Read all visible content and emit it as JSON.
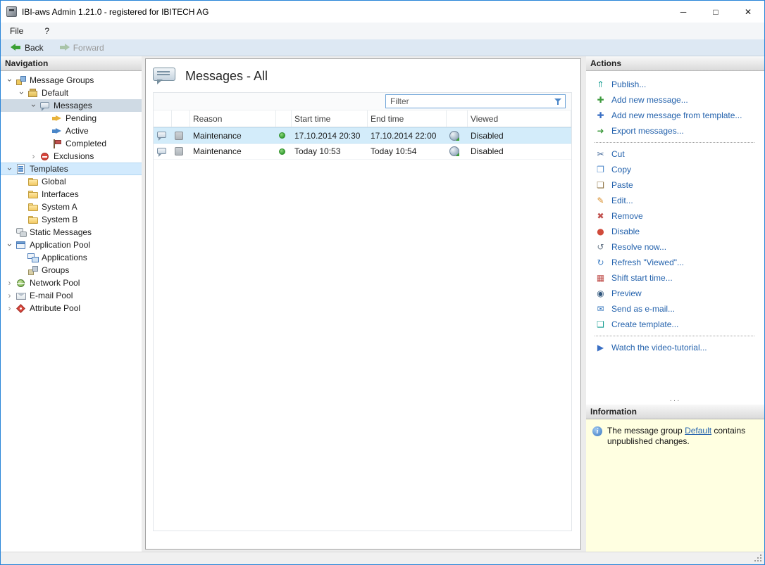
{
  "window": {
    "title": "IBI-aws Admin 1.21.0 - registered for IBITECH AG",
    "controls": {
      "minimize": "─",
      "maximize": "□",
      "close": "✕"
    }
  },
  "menu": {
    "items": [
      {
        "label": "File"
      },
      {
        "label": "?"
      }
    ]
  },
  "toolbar": {
    "back_label": "Back",
    "forward_label": "Forward"
  },
  "navigation": {
    "header": "Navigation",
    "tree": [
      {
        "label": "Message Groups",
        "level": 0,
        "children": "expanded",
        "icon": "message-groups-icon"
      },
      {
        "label": "Default",
        "level": 1,
        "children": "expanded",
        "icon": "message-group-icon"
      },
      {
        "label": "Messages",
        "level": 2,
        "children": "expanded",
        "icon": "messages-icon",
        "state": "selected"
      },
      {
        "label": "Pending",
        "level": 3,
        "children": null,
        "icon": "pending-icon"
      },
      {
        "label": "Active",
        "level": 3,
        "children": null,
        "icon": "active-icon"
      },
      {
        "label": "Completed",
        "level": 3,
        "children": null,
        "icon": "completed-icon"
      },
      {
        "label": "Exclusions",
        "level": 2,
        "children": "collapsed",
        "icon": "exclusions-icon"
      },
      {
        "label": "Templates",
        "level": 0,
        "children": "expanded",
        "icon": "templates-icon",
        "state": "highlighted"
      },
      {
        "label": "Global",
        "level": 1,
        "children": null,
        "icon": "folder-icon"
      },
      {
        "label": "Interfaces",
        "level": 1,
        "children": null,
        "icon": "folder-icon"
      },
      {
        "label": "System A",
        "level": 1,
        "children": null,
        "icon": "folder-icon"
      },
      {
        "label": "System B",
        "level": 1,
        "children": null,
        "icon": "folder-icon"
      },
      {
        "label": "Static Messages",
        "level": 0,
        "children": null,
        "icon": "static-messages-icon"
      },
      {
        "label": "Application Pool",
        "level": 0,
        "children": "expanded",
        "icon": "application-pool-icon"
      },
      {
        "label": "Applications",
        "level": 1,
        "children": null,
        "icon": "applications-icon"
      },
      {
        "label": "Groups",
        "level": 1,
        "children": null,
        "icon": "groups-icon"
      },
      {
        "label": "Network Pool",
        "level": 0,
        "children": "collapsed",
        "icon": "network-pool-icon"
      },
      {
        "label": "E-mail Pool",
        "level": 0,
        "children": "collapsed",
        "icon": "email-pool-icon"
      },
      {
        "label": "Attribute Pool",
        "level": 0,
        "children": "collapsed",
        "icon": "attribute-pool-icon"
      }
    ]
  },
  "main": {
    "title": "Messages - All",
    "filter_placeholder": "Filter",
    "table": {
      "columns": [
        "Reason",
        "Start time",
        "End time",
        "Viewed"
      ],
      "rows": [
        {
          "reason": "Maintenance",
          "status": "active",
          "start_time": "17.10.2014 20:30",
          "end_time": "17.10.2014 22:00",
          "viewed": "Disabled",
          "selected": true
        },
        {
          "reason": "Maintenance",
          "status": "active",
          "start_time": "Today 10:53",
          "end_time": "Today 10:54",
          "viewed": "Disabled",
          "selected": false
        }
      ]
    }
  },
  "actions": {
    "header": "Actions",
    "overflow_indicator": "···",
    "groups": [
      [
        {
          "label": "Publish...",
          "icon": "publish-icon"
        },
        {
          "label": "Add new message...",
          "icon": "add-message-icon"
        },
        {
          "label": "Add new message from template...",
          "icon": "add-message-template-icon"
        },
        {
          "label": "Export messages...",
          "icon": "export-messages-icon"
        }
      ],
      [
        {
          "label": "Cut",
          "icon": "cut-icon"
        },
        {
          "label": "Copy",
          "icon": "copy-icon"
        },
        {
          "label": "Paste",
          "icon": "paste-icon"
        },
        {
          "label": "Edit...",
          "icon": "edit-icon"
        },
        {
          "label": "Remove",
          "icon": "remove-icon"
        },
        {
          "label": "Disable",
          "icon": "disable-icon"
        },
        {
          "label": "Resolve now...",
          "icon": "resolve-icon"
        },
        {
          "label": "Refresh \"Viewed\"...",
          "icon": "refresh-viewed-icon"
        },
        {
          "label": "Shift start time...",
          "icon": "shift-time-icon"
        },
        {
          "label": "Preview",
          "icon": "preview-icon"
        },
        {
          "label": "Send as e-mail...",
          "icon": "send-email-icon"
        },
        {
          "label": "Create template...",
          "icon": "create-template-icon"
        }
      ],
      [
        {
          "label": "Watch the video-tutorial...",
          "icon": "video-tutorial-icon"
        }
      ]
    ]
  },
  "information": {
    "header": "Information",
    "message": {
      "prefix": "The message group ",
      "link": "Default",
      "suffix": " contains unpublished changes."
    }
  }
}
